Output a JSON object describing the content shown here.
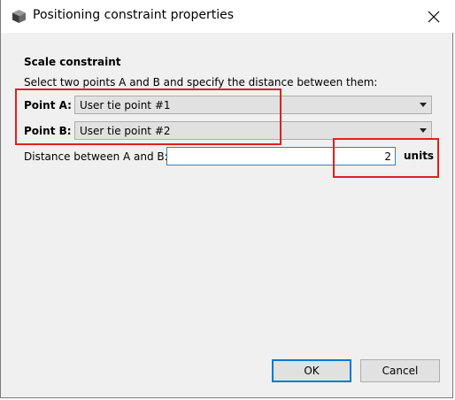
{
  "window": {
    "title": "Positioning constraint properties",
    "icon": "cube-icon",
    "close_icon": "close-icon"
  },
  "section": {
    "title": "Scale constraint",
    "instructions": "Select two points A and B and specify the distance between them:"
  },
  "point_a": {
    "label": "Point A:",
    "value": "User tie point #1"
  },
  "point_b": {
    "label": "Point B:",
    "value": "User tie point #2"
  },
  "distance": {
    "label": "Distance between A and B:",
    "value": "2",
    "units": "units"
  },
  "buttons": {
    "ok": "OK",
    "cancel": "Cancel"
  },
  "colors": {
    "highlight": "#e02020",
    "focus": "#0078d7"
  }
}
